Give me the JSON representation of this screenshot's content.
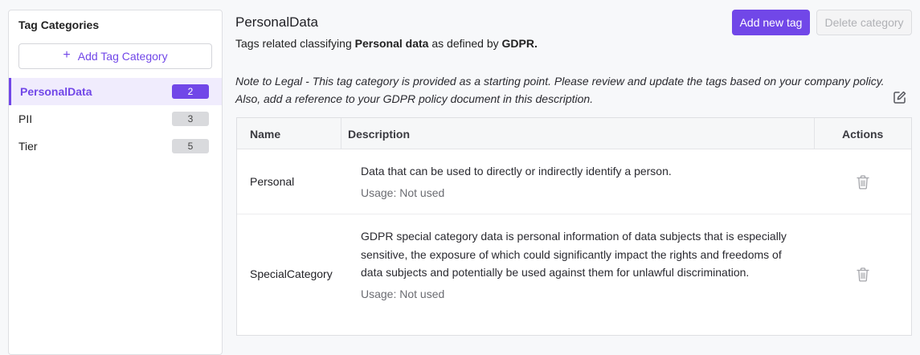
{
  "sidebar": {
    "title": "Tag Categories",
    "add_button_icon": "plus-icon",
    "add_button_label": "Add Tag Category",
    "items": [
      {
        "label": "PersonalData",
        "count": "2"
      },
      {
        "label": "PII",
        "count": "3"
      },
      {
        "label": "Tier",
        "count": "5"
      }
    ]
  },
  "main": {
    "title": "PersonalData",
    "add_tag_label": "Add new tag",
    "delete_category_label": "Delete category",
    "description": {
      "prefix": "Tags related classifying ",
      "bold1": "Personal data",
      "middle": " as defined by ",
      "bold2": "GDPR."
    },
    "note": "Note to Legal - This tag category is provided as a starting point. Please review and update the tags based on your company policy. Also, add a reference to your GDPR policy document in this description.",
    "edit_icon": "edit-icon"
  },
  "table": {
    "columns": [
      "Name",
      "Description",
      "Actions"
    ],
    "rows": [
      {
        "name": "Personal",
        "description": "Data that can be used to directly or indirectly identify a person.",
        "usage": "Usage: Not used",
        "action_icon": "trash-icon"
      },
      {
        "name": "SpecialCategory",
        "description": "GDPR special category data is personal information of data subjects that is especially sensitive, the exposure of which could significantly impact the rights and freedoms of data subjects and potentially be used against them for unlawful discrimination.",
        "usage": "Usage: Not used",
        "action_icon": "trash-icon"
      }
    ]
  },
  "colors": {
    "accent": "#7147e8",
    "active_bg": "#f0ecfd",
    "badge_bg": "#d9dadd"
  }
}
